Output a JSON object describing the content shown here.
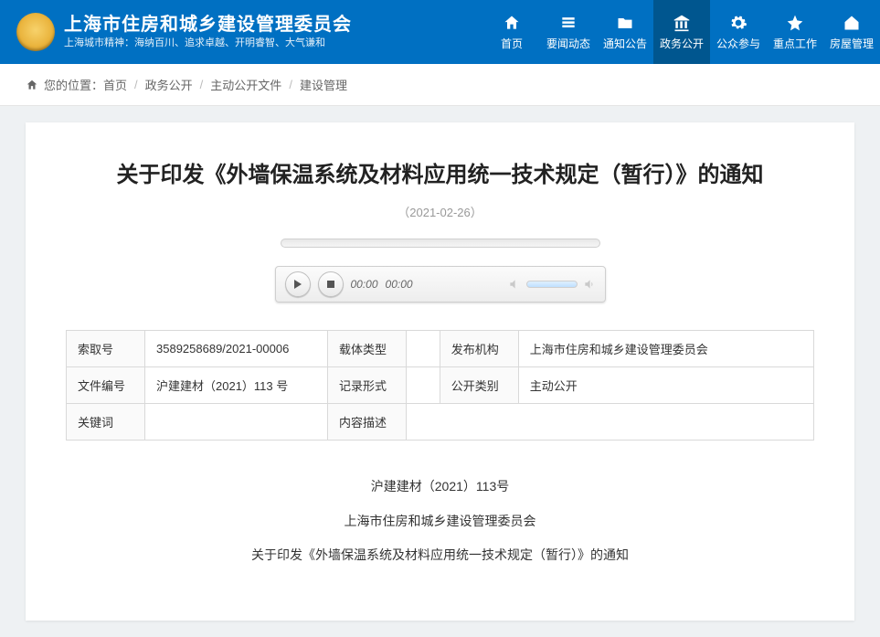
{
  "header": {
    "site_title": "上海市住房和城乡建设管理委员会",
    "site_sub": "上海城市精神：海纳百川、追求卓越、开明睿智、大气谦和",
    "nav": [
      {
        "label": "首页",
        "icon": "home",
        "active": false
      },
      {
        "label": "要闻动态",
        "icon": "news",
        "active": false
      },
      {
        "label": "通知公告",
        "icon": "folder",
        "active": false
      },
      {
        "label": "政务公开",
        "icon": "gov",
        "active": true
      },
      {
        "label": "公众参与",
        "icon": "gear",
        "active": false
      },
      {
        "label": "重点工作",
        "icon": "star",
        "active": false
      },
      {
        "label": "房屋管理",
        "icon": "house",
        "active": false
      }
    ]
  },
  "breadcrumb": {
    "label": "您的位置：",
    "items": [
      "首页",
      "政务公开",
      "主动公开文件",
      "建设管理"
    ]
  },
  "article": {
    "title": "关于印发《外墙保温系统及材料应用统一技术规定（暂行）》的通知",
    "date": "（2021-02-26）",
    "audio": {
      "current": "00:00",
      "total": "00:00"
    },
    "meta": {
      "index_no_label": "索取号",
      "index_no": "3589258689/2021-00006",
      "carrier_label": "载体类型",
      "carrier": "",
      "publisher_label": "发布机构",
      "publisher": "上海市住房和城乡建设管理委员会",
      "doc_no_label": "文件编号",
      "doc_no": "沪建建材（2021）113 号",
      "record_label": "记录形式",
      "record": "",
      "open_type_label": "公开类别",
      "open_type": "主动公开",
      "keyword_label": "关键词",
      "keyword": "",
      "desc_label": "内容描述",
      "desc": ""
    },
    "body": [
      "沪建建材（2021）113号",
      "上海市住房和城乡建设管理委员会",
      "关于印发《外墙保温系统及材料应用统一技术规定（暂行）》的通知"
    ]
  }
}
